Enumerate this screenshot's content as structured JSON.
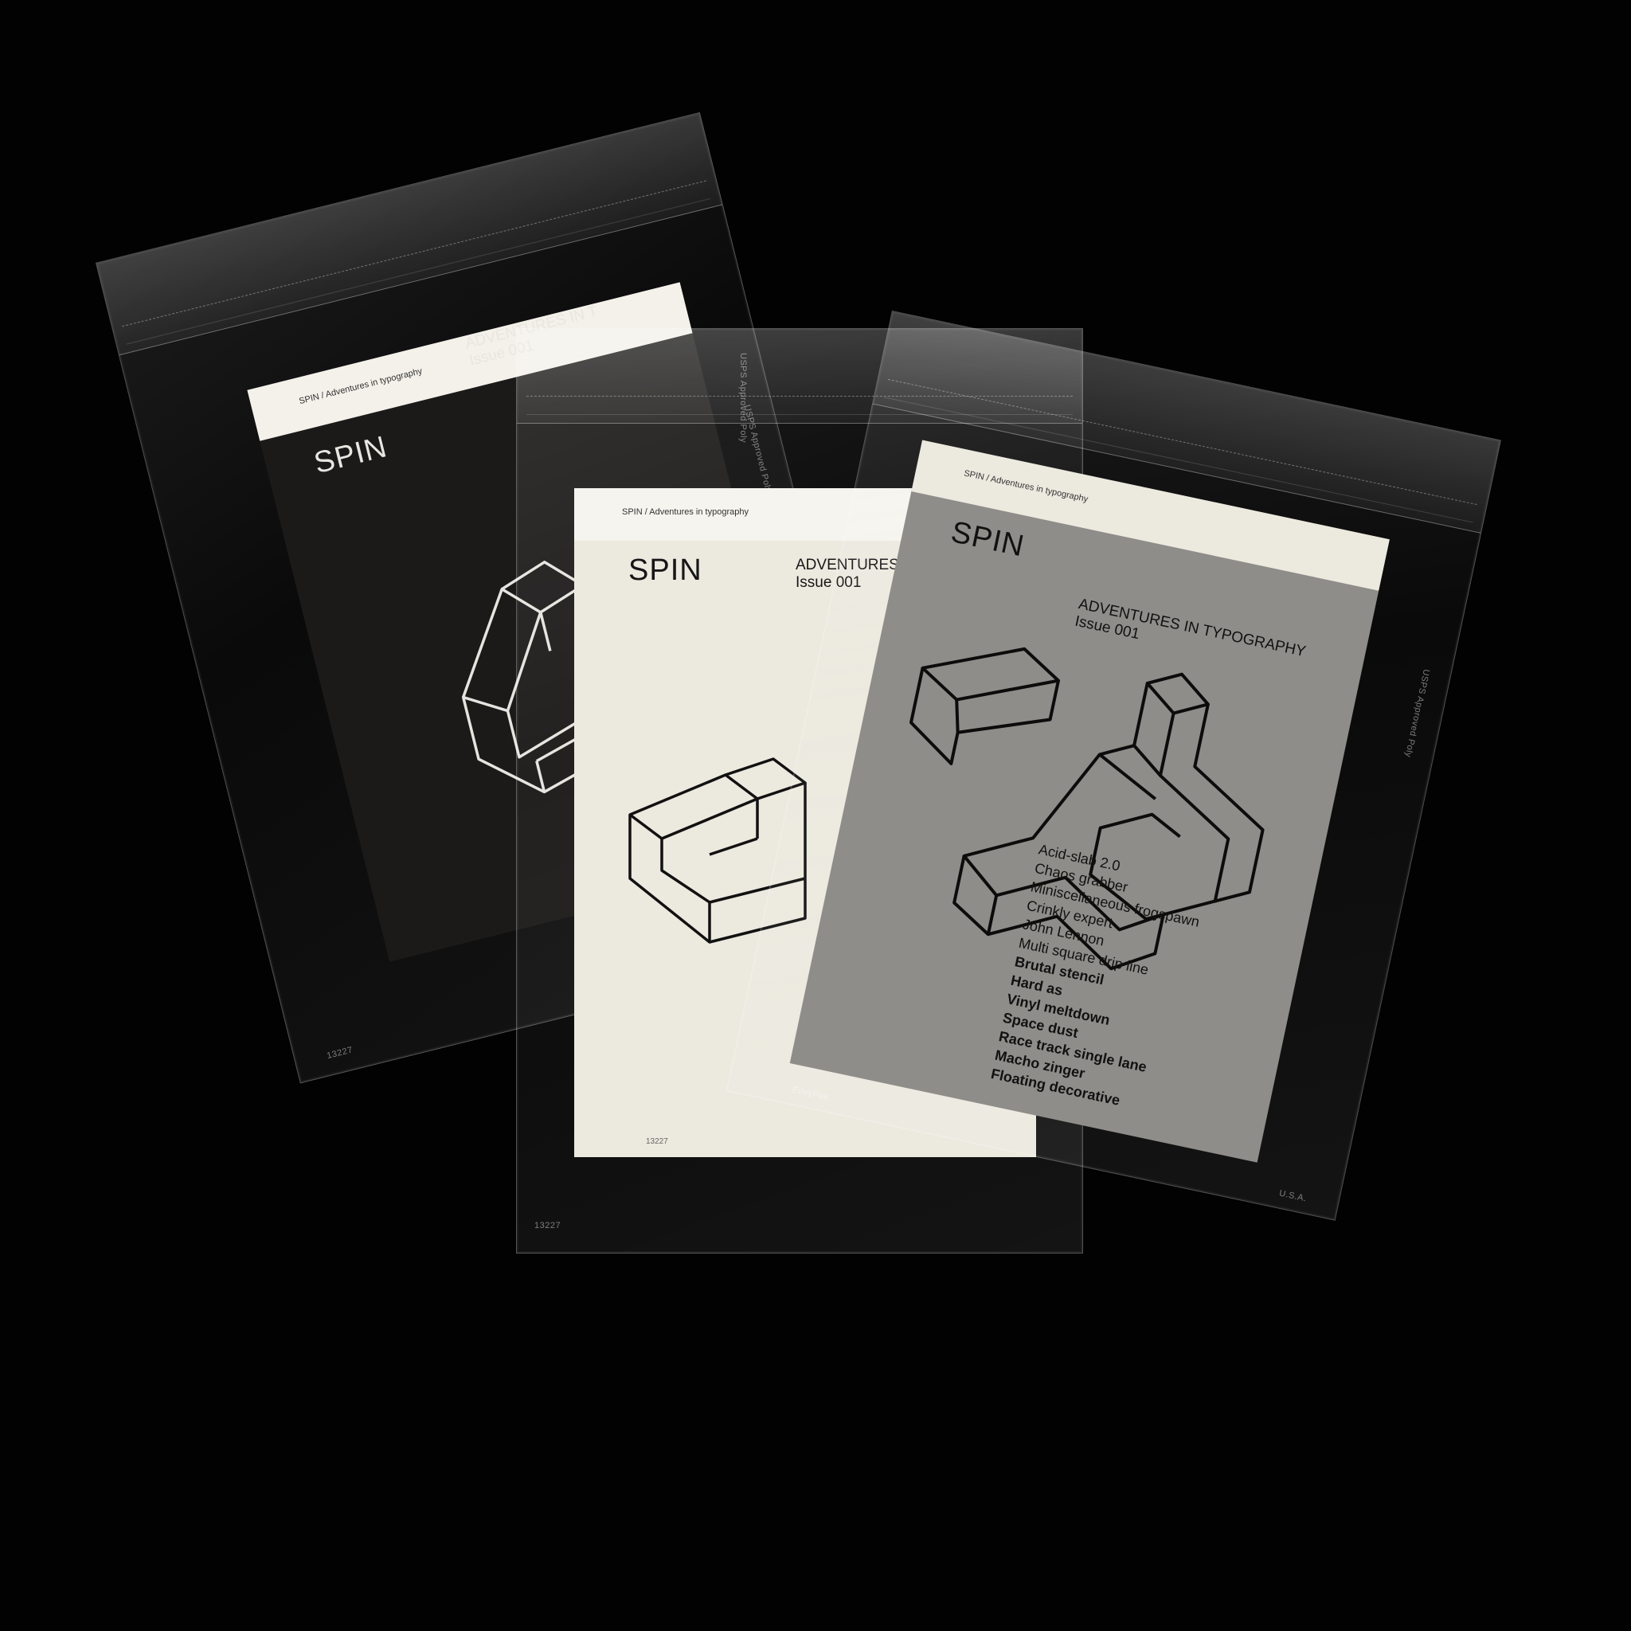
{
  "scene": {
    "subject": "three-spin-booklets-in-clear-sleeves"
  },
  "booklets": [
    {
      "band_text": "SPIN / Adventures in typography",
      "title": "SPIN",
      "headline_1": "ADVENTURES IN T",
      "headline_2": "Issue 001",
      "cover_color": "#1c1a19"
    },
    {
      "band_text": "SPIN / Adventures in typography",
      "title": "SPIN",
      "headline_1": "ADVENTURES",
      "headline_2": "Issue 001",
      "cover_color": "#ece9df",
      "code": "13227"
    },
    {
      "band_text": "SPIN / Adventures in typography",
      "title": "SPIN",
      "headline_1": "ADVENTURES IN TYPOGRAPHY",
      "headline_2": "Issue 001",
      "cover_color": "#8f8d89",
      "contents": [
        "Acid-slab 2.0",
        "Chaos grabber",
        "Miniscellaneous frogspawn",
        "Crinkly expert",
        "John Lennon",
        "Multi square drip line",
        "Brutal stencil",
        "Hard as",
        "Vinyl meltdown",
        "Space dust",
        "Race track single lane",
        "Macho zinger",
        "Floating decorative"
      ]
    }
  ],
  "sleeve_prints": {
    "vertical_label": "USPS Approved Poly",
    "code": "13227",
    "maker": "EnvyPak",
    "origin": "U.S.A."
  }
}
